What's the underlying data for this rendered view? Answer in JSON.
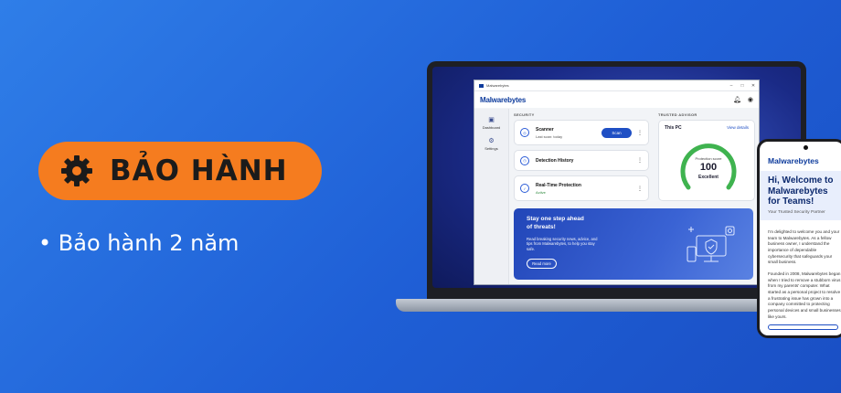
{
  "promo": {
    "badge_label": "BẢO HÀNH",
    "bullet_text": "• Bảo hành 2 năm",
    "badge_color": "#f57c1f",
    "badge_icon": "gear-icon"
  },
  "app": {
    "window_title": "Malwarebytes",
    "brand": "Malwarebytes",
    "header_icons": [
      "bell-icon",
      "account-icon"
    ],
    "sidebar": [
      {
        "label": "Dashboard",
        "icon": "dashboard-icon"
      },
      {
        "label": "Settings",
        "icon": "gear-icon"
      }
    ],
    "security": {
      "section_label": "SECURITY",
      "scanner": {
        "title": "Scanner",
        "subtitle": "Last scan: today",
        "button": "Scan"
      },
      "detection": {
        "title": "Detection History"
      },
      "realtime": {
        "title": "Real-Time Protection",
        "status": "Active"
      }
    },
    "advisor": {
      "section_label": "TRUSTED ADVISOR",
      "device": "This PC",
      "link": "View details",
      "score_label": "Protection score",
      "score": "100",
      "score_value": 100,
      "rating": "Excellent"
    },
    "promo_card": {
      "title": "Stay one step ahead of threats!",
      "body": "Read breaking security news, advice, and tips from Malwarebytes, to help you stay safe.",
      "button": "Read more"
    }
  },
  "phone": {
    "brand": "Malwarebytes",
    "hero_title": "Hi, Welcome to Malwarebytes for Teams!",
    "tagline": "Your Trusted Security Partner",
    "para1": "I'm delighted to welcome you and your team to Malwarebytes. As a fellow business owner, I understand the importance of dependable cybersecurity that safeguards your small business.",
    "para2": "Founded in 2008, Malwarebytes began when I tried to remove a stubborn virus from my parents' computer. What started as a personal project to resolve a frustrating issue has grown into a company committed to protecting personal devices and small businesses like yours."
  }
}
